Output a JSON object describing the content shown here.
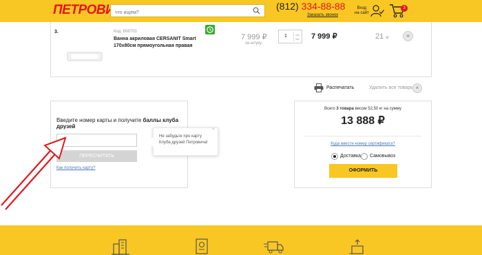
{
  "header": {
    "logo": "ПЕТРОВИЧ",
    "search_placeholder": "что ищем?",
    "phone_prefix": "(812)",
    "phone_number": "334-88-88",
    "callback_label": "Заказать звонок",
    "login_line1": "Вход",
    "login_line2": "на сайт",
    "cart_count": "3"
  },
  "item": {
    "number": "3.",
    "code": "Код: 608703",
    "name": "Ванна акриловая CERSANIT Smart 170x80см прямоугольная правая",
    "unit_price": "7 999 ₽",
    "unit_label": "за штуку",
    "quantity": "1",
    "total_price": "7 999 ₽",
    "weight_value": "21",
    "weight_unit": "кг"
  },
  "actions": {
    "print_label": "Распечатать",
    "remove_all_label": "Удалить все товары"
  },
  "card": {
    "heading_prefix": "Введите номер карты и получите ",
    "heading_bold": "баллы клуба друзей",
    "recalc_label": "ПЕРЕСЧИТАТЬ",
    "get_card_link": "Как получить карту?",
    "tooltip_text": "Не забудьте про карту Клуба друзей Петровича!",
    "tooltip_close": "×"
  },
  "summary": {
    "text_prefix": "Всего ",
    "items_bold": "3 товара",
    "text_suffix": " весом 52,50 кг на сумму",
    "total": "13 888 ₽",
    "certificate_link": "Куда ввести номер сертификата?",
    "delivery_label": "Доставка",
    "pickup_label": "Самовывоз",
    "order_label": "ОФОРМИТЬ"
  },
  "colors": {
    "brand_yellow": "#f9c723",
    "brand_red": "#e3161b",
    "link_blue": "#4a7ab5",
    "club_green": "#3da832"
  }
}
